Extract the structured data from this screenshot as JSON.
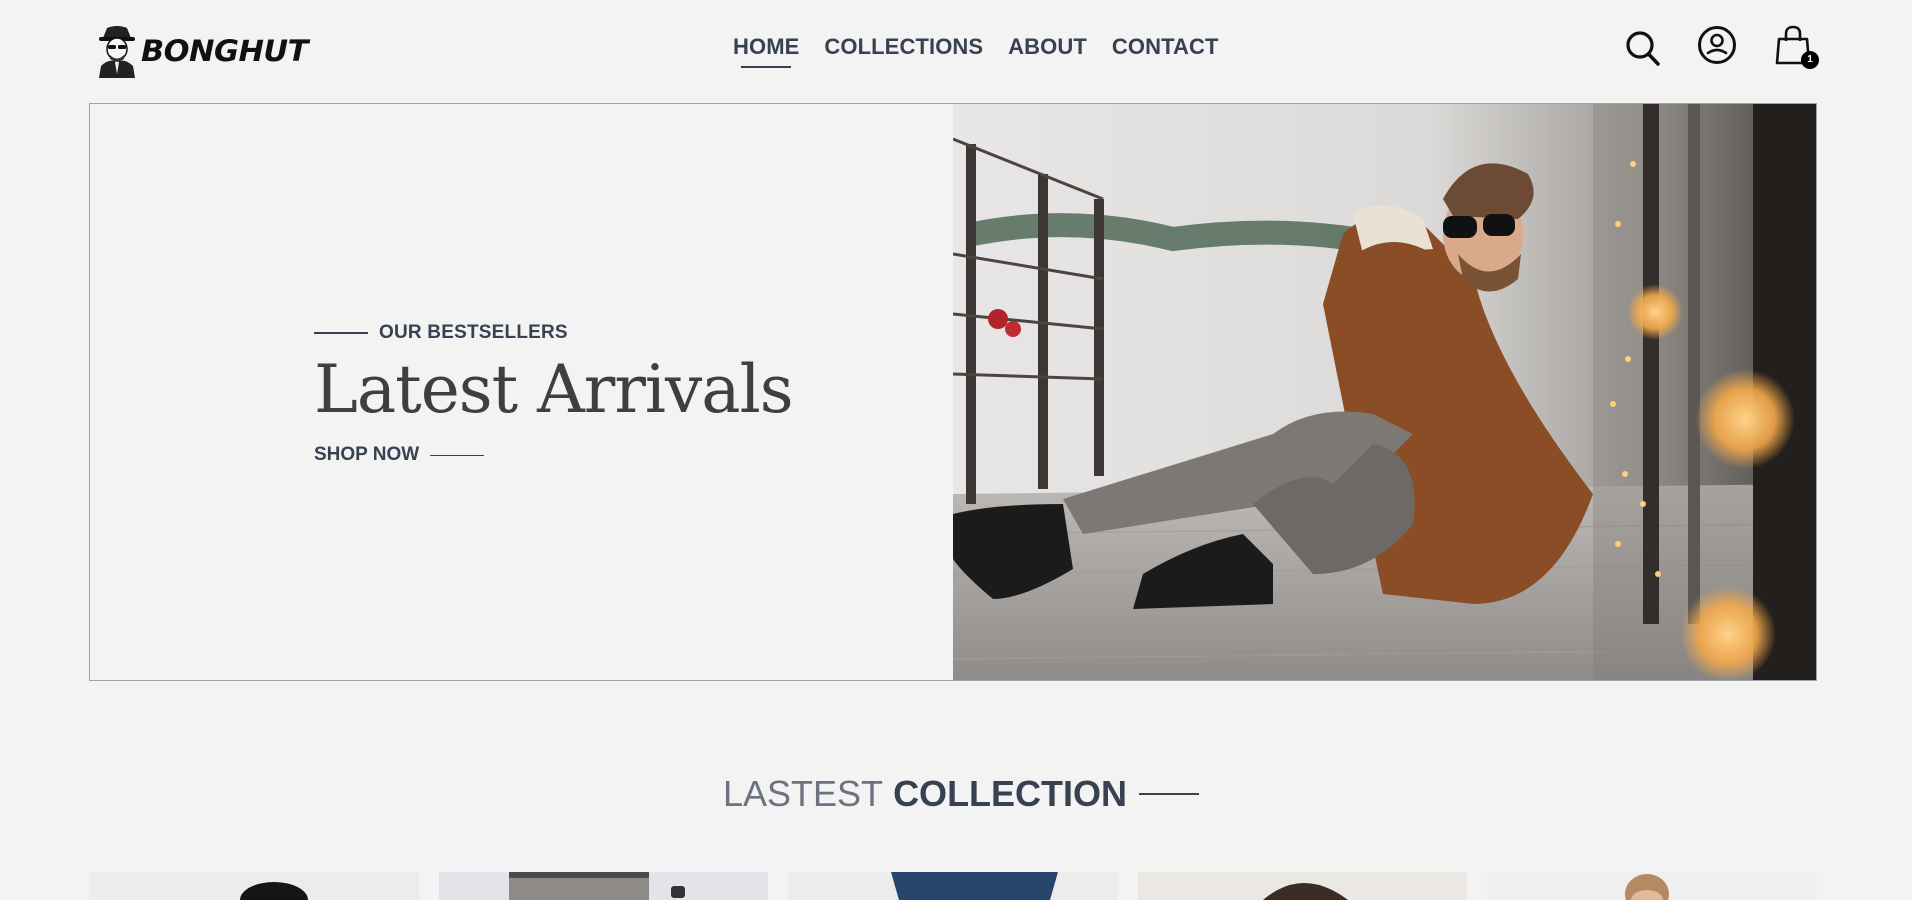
{
  "brand": {
    "name": "BONGHUT"
  },
  "nav": {
    "items": [
      {
        "label": "HOME",
        "active": true
      },
      {
        "label": "COLLECTIONS",
        "active": false
      },
      {
        "label": "ABOUT",
        "active": false
      },
      {
        "label": "CONTACT",
        "active": false
      }
    ]
  },
  "header_icons": {
    "search": "search-icon",
    "profile": "user-icon",
    "cart": "cart-icon",
    "cart_count": "1"
  },
  "hero": {
    "kicker": "OUR BESTSELLERS",
    "title": "Latest Arrivals",
    "cta": "SHOP NOW",
    "image": "man-sitting-on-porch-photo"
  },
  "latest_collection": {
    "title_light": "LASTEST",
    "title_bold": "COLLECTION",
    "products": [
      {
        "image": "product-photo-1"
      },
      {
        "image": "product-photo-2"
      },
      {
        "image": "product-photo-3"
      },
      {
        "image": "product-photo-4"
      },
      {
        "image": "product-photo-5"
      }
    ]
  },
  "colors": {
    "background": "#f3f3f3",
    "text": "#374151",
    "muted": "#6b7280",
    "border": "#9ca3af"
  }
}
